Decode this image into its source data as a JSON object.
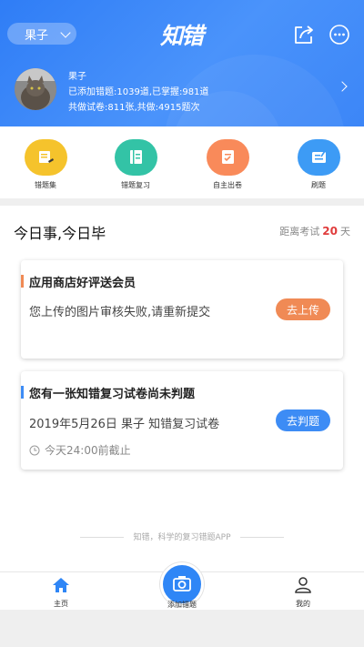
{
  "header": {
    "profile_select": "果子",
    "logo_text": "知错",
    "user": {
      "name": "果子",
      "stats_line1": "已添加错题:1039道,已掌握:981道",
      "stats_line2": "共做试卷:811张,共做:4915题次"
    }
  },
  "actions": [
    {
      "label": "错题集",
      "color": "#f5c32c",
      "icon": "error-book-icon"
    },
    {
      "label": "错题复习",
      "color": "#33c3a6",
      "icon": "review-book-icon"
    },
    {
      "label": "自主出卷",
      "color": "#f98a5a",
      "icon": "create-paper-icon"
    },
    {
      "label": "刷题",
      "color": "#3d9bf5",
      "icon": "practice-icon"
    }
  ],
  "main": {
    "title": "今日事,今日毕",
    "exam_prefix": "距离考试",
    "exam_days": "20",
    "exam_suffix": "天",
    "cards": [
      {
        "title": "应用商店好评送会员",
        "body": "您上传的图片审核失败,请重新提交",
        "button": "去上传",
        "accent": "#f08a55"
      },
      {
        "title": "您有一张知错复习试卷尚未判题",
        "body": "2019年5月26日 果子 知错复习试卷",
        "button": "去判题",
        "deadline": "今天24:00前截止",
        "accent": "#3d8cf5"
      }
    ],
    "footer_note": "知错，科学的复习错题APP"
  },
  "tabbar": {
    "home": "主页",
    "add": "添加错题",
    "mine": "我的",
    "active_color": "#2f86f6"
  }
}
